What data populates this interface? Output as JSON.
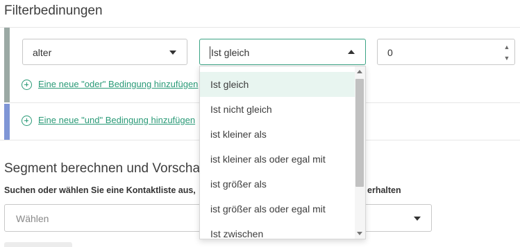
{
  "filter_section": {
    "title": "Filterbedinungen",
    "condition": {
      "field_value": "alter",
      "operator_value": "Ist gleich",
      "number_value": "0"
    },
    "add_or_label": "Eine neue \"oder\" Bedingung hinzufügen",
    "add_and_label": "Eine neue \"und\" Bedingung hinzufügen"
  },
  "operator_dropdown": {
    "options": [
      "Ist gleich",
      "Ist nicht gleich",
      "ist kleiner als",
      "ist kleiner als oder egal mit",
      "ist größer als",
      "ist größer als oder egal mit",
      "Ist zwischen"
    ],
    "selected_index": 0
  },
  "segment_section": {
    "title": "Segment berechnen und Vorschau",
    "helper_text": "Suchen oder wählen Sie eine Kontaktliste aus,",
    "helper_text_end": "erhalten",
    "contact_placeholder": "Wählen"
  },
  "colors": {
    "accent": "#2a9a77",
    "or_bar": "#9ba9a4",
    "and_bar": "#7f96d6",
    "selected_option_bg": "#e8f5f0"
  },
  "icons": {
    "add": "plus-circle-icon",
    "dropdown": "caret-down-icon",
    "dropdown_open": "caret-up-icon",
    "spinner": "number-spinner-icon"
  }
}
